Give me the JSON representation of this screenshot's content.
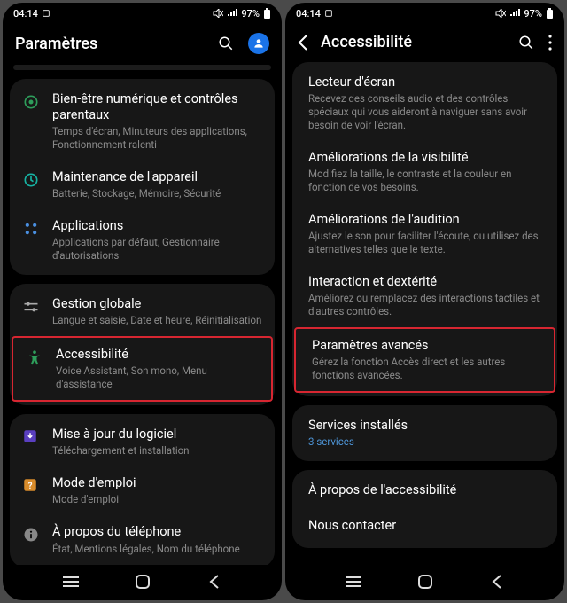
{
  "status": {
    "time": "04:14",
    "battery": "97%"
  },
  "left": {
    "title": "Paramètres",
    "groups": [
      [
        {
          "icon": "wellbeing",
          "title": "Bien-être numérique et contrôles parentaux",
          "sub": "Temps d'écran, Minuteurs des applications, Fonctionnement ralenti"
        },
        {
          "icon": "device-care",
          "title": "Maintenance de l'appareil",
          "sub": "Batterie, Stockage, Mémoire, Sécurité"
        },
        {
          "icon": "apps",
          "title": "Applications",
          "sub": "Applications par défaut, Gestionnaire d'autorisations"
        }
      ],
      [
        {
          "icon": "sliders",
          "title": "Gestion globale",
          "sub": "Langue et saisie, Date et heure, Réinitialisation"
        },
        {
          "icon": "accessibility",
          "title": "Accessibilité",
          "sub": "Voice Assistant, Son mono, Menu d'assistance",
          "hl": true
        }
      ],
      [
        {
          "icon": "update",
          "title": "Mise à jour du logiciel",
          "sub": "Téléchargement et installation"
        },
        {
          "icon": "manual",
          "title": "Mode d'emploi",
          "sub": "Mode d'emploi"
        },
        {
          "icon": "info",
          "title": "À propos du téléphone",
          "sub": "État, Mentions légales, Nom du téléphone"
        }
      ]
    ]
  },
  "right": {
    "title": "Accessibilité",
    "groups": [
      [
        {
          "title": "Lecteur d'écran",
          "sub": "Recevez des conseils audio et des contrôles spéciaux qui vous aideront à naviguer sans avoir besoin de voir l'écran."
        },
        {
          "title": "Améliorations de la visibilité",
          "sub": "Modifiez la taille, le contraste et la couleur en fonction de vos besoins."
        },
        {
          "title": "Améliorations de l'audition",
          "sub": "Ajustez le son pour faciliter l'écoute, ou utilisez des alternatives telles que le texte."
        },
        {
          "title": "Interaction et dextérité",
          "sub": "Améliorez ou remplacez des interactions tactiles et d'autres contrôles."
        },
        {
          "title": "Paramètres avancés",
          "sub": "Gérez la fonction Accès direct et les autres fonctions avancées.",
          "hl": true
        }
      ],
      [
        {
          "title": "Services installés",
          "sub": "3 services",
          "link": true
        }
      ],
      [
        {
          "title": "À propos de l'accessibilité"
        },
        {
          "title": "Nous contacter"
        }
      ]
    ]
  }
}
